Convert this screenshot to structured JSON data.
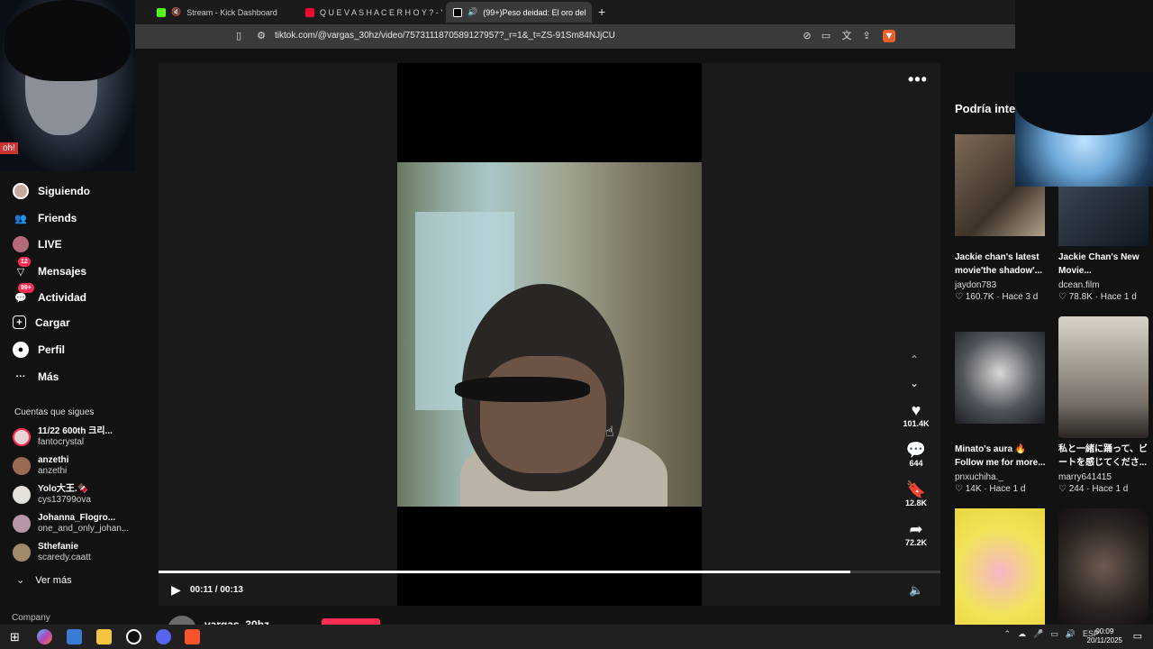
{
  "browser": {
    "tabs": [
      {
        "label": "Stream - Kick Dashboard",
        "color": "#53fc18"
      },
      {
        "label": "Q U E V A S H A C E R H O Y ? - YouT",
        "color": "#ff0033"
      },
      {
        "label": "(99+)Peso deidad: El oro del",
        "color": "#ffffff"
      }
    ],
    "new_tab": "+",
    "url": "tiktok.com/@vargas_30hz/video/7573111870589127957?_r=1&_t=ZS-91Sm84NJjCU"
  },
  "webcam": {
    "tag": "oh!"
  },
  "sidebar": {
    "nav": [
      {
        "label": "Siguiendo",
        "icon": "avatar-icon"
      },
      {
        "label": "Friends",
        "icon": "friends-icon"
      },
      {
        "label": "LIVE",
        "icon": "live-icon"
      },
      {
        "label": "Mensajes",
        "icon": "messages-icon",
        "badge": "12"
      },
      {
        "label": "Actividad",
        "icon": "activity-icon",
        "badge": "99+"
      },
      {
        "label": "Cargar",
        "icon": "upload-icon"
      },
      {
        "label": "Perfil",
        "icon": "profile-icon"
      },
      {
        "label": "Más",
        "icon": "more-icon"
      }
    ],
    "following_title": "Cuentas que sigues",
    "following": [
      {
        "name": "11/22 600th 크리...",
        "handle": "fantocrystal"
      },
      {
        "name": "anzethi",
        "handle": "anzethi"
      },
      {
        "name": "Yolo大王.🍫",
        "handle": "cys13799ova"
      },
      {
        "name": "Johanna_Flogro...",
        "handle": "one_and_only_johan..."
      },
      {
        "name": "Sthefanie",
        "handle": "scaredy.caatt"
      }
    ],
    "see_more": "Ver más",
    "company": "Company"
  },
  "video": {
    "more_icon": "•••",
    "likes": "101.4K",
    "comments": "644",
    "saves": "12.8K",
    "shares": "72.2K",
    "time": "00:11 / 00:13",
    "progress": 0.885,
    "author": "vargas_30hz"
  },
  "recommendations": {
    "title": "Podría inter",
    "items": [
      {
        "title": "Jackie chan's latest movie'the shadow'...",
        "user": "jaydon783",
        "meta": "♡ 160.7K · Hace 3 d"
      },
      {
        "title": "Jackie Chan's New Movie...",
        "user": "dcean.film",
        "meta": "♡ 78.8K · Hace 1 d"
      },
      {
        "title": "Minato's aura 🔥 Follow me for more...",
        "user": "pnxuchiha._",
        "meta": "♡ 14K · Hace 1 d"
      },
      {
        "title": "私と一緒に踊って、ビートを感じてくださ...",
        "user": "marry641415",
        "meta": "♡ 244 · Hace 1 d"
      }
    ]
  },
  "taskbar": {
    "lang": "ESP",
    "time": "00:09",
    "date": "20/11/2025"
  }
}
